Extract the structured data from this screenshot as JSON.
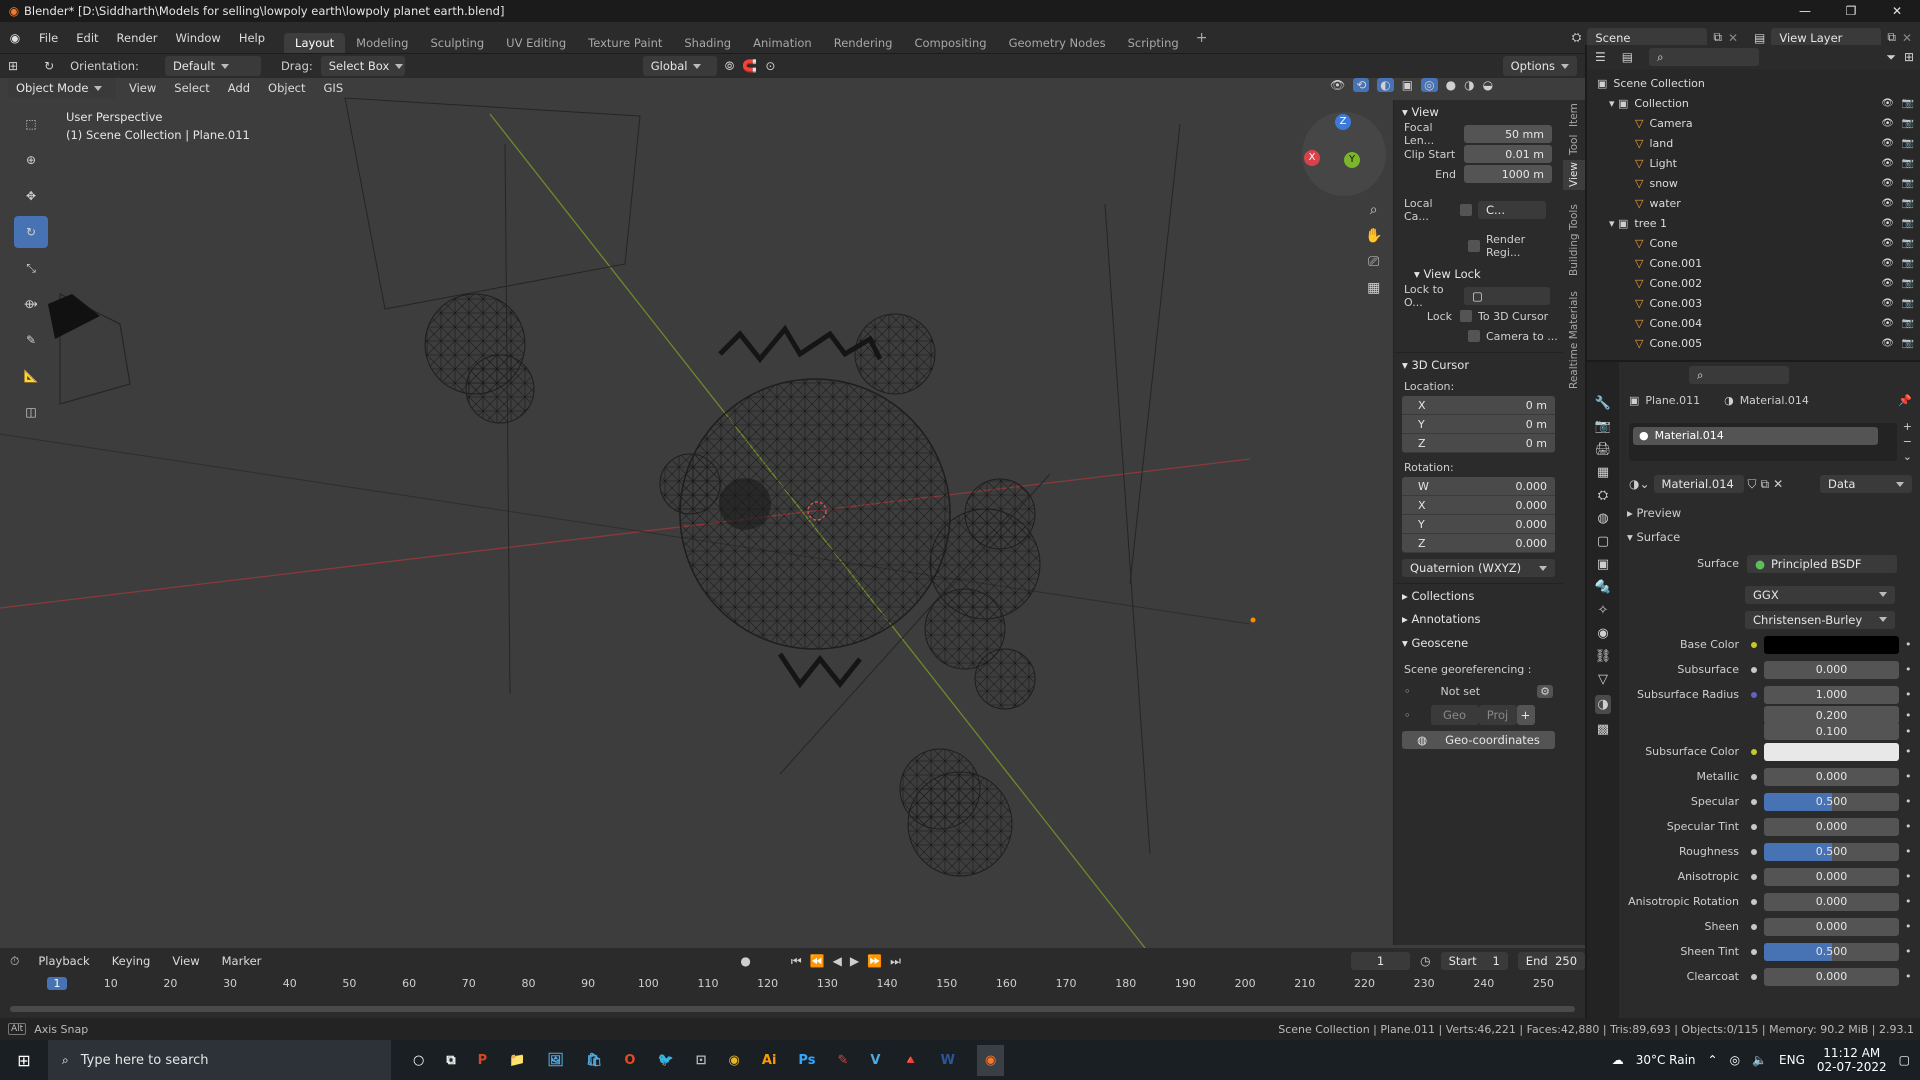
{
  "window": {
    "title": "Blender* [D:\\Siddharth\\Models for selling\\lowpoly earth\\lowpoly planet earth.blend]"
  },
  "menubar": {
    "menus": [
      "File",
      "Edit",
      "Render",
      "Window",
      "Help"
    ],
    "workspaces": [
      "Layout",
      "Modeling",
      "Sculpting",
      "UV Editing",
      "Texture Paint",
      "Shading",
      "Animation",
      "Rendering",
      "Compositing",
      "Geometry Nodes",
      "Scripting"
    ],
    "add_tab": "+",
    "scene_label": "Scene",
    "view_layer_label": "View Layer"
  },
  "viewport_header": {
    "orientation_label": "Orientation:",
    "orientation_value": "Default",
    "drag_label": "Drag:",
    "drag_value": "Select Box",
    "transform_orientation": "Global",
    "options": "Options",
    "mode": "Object Mode",
    "menus": [
      "View",
      "Select",
      "Add",
      "Object",
      "GIS"
    ]
  },
  "viewport": {
    "perspective": "User Perspective",
    "context": "(1) Scene Collection | Plane.011",
    "gizmo": {
      "x": "X",
      "y": "Y",
      "z": "Z"
    }
  },
  "npanel": {
    "view": {
      "header": "View",
      "focal_label": "Focal Len...",
      "focal_value": "50 mm",
      "clip_start_label": "Clip Start",
      "clip_start_value": "0.01 m",
      "end_label": "End",
      "end_value": "1000 m",
      "local_camera_label": "Local Ca...",
      "local_camera_value": "C...",
      "render_region": "Render Regi..."
    },
    "view_lock": {
      "header": "View Lock",
      "lock_to_label": "Lock to O...",
      "lock_label": "Lock",
      "to_cursor": "To 3D Cursor",
      "camera_to": "Camera to ..."
    },
    "cursor": {
      "header": "3D Cursor",
      "location_label": "Location:",
      "location": [
        {
          "axis": "X",
          "value": "0 m"
        },
        {
          "axis": "Y",
          "value": "0 m"
        },
        {
          "axis": "Z",
          "value": "0 m"
        }
      ],
      "rotation_label": "Rotation:",
      "rotation": [
        {
          "axis": "W",
          "value": "0.000"
        },
        {
          "axis": "X",
          "value": "0.000"
        },
        {
          "axis": "Y",
          "value": "0.000"
        },
        {
          "axis": "Z",
          "value": "0.000"
        }
      ],
      "rotation_mode": "Quaternion (WXYZ)"
    },
    "collections": "Collections",
    "annotations": "Annotations",
    "geoscene": {
      "header": "Geoscene",
      "georef_label": "Scene georeferencing :",
      "not_set": "Not set",
      "geo": "Geo",
      "proj": "Proj",
      "plus": "+",
      "geo_coordinates": "Geo-coordinates"
    },
    "tabs": [
      "Item",
      "Tool",
      "View",
      "Building Tools",
      "Realtime Materials"
    ]
  },
  "outliner": {
    "root": "Scene Collection",
    "collection": "Collection",
    "items": [
      "Camera",
      "land",
      "Light",
      "snow",
      "water"
    ],
    "tree": "tree 1",
    "tree_items": [
      "Cone",
      "Cone.001",
      "Cone.002",
      "Cone.003",
      "Cone.004",
      "Cone.005"
    ]
  },
  "properties": {
    "object_name": "Plane.011",
    "material_header": "Material.014",
    "slot_name": "Material.014",
    "material_name": "Material.014",
    "link": "Data",
    "preview": "Preview",
    "surface_header": "Surface",
    "surface_label": "Surface",
    "surface_value": "Principled BSDF",
    "distribution": "GGX",
    "subsurface_method": "Christensen-Burley",
    "rows": [
      {
        "label": "Base Color",
        "type": "color",
        "value": "",
        "color": "#000000"
      },
      {
        "label": "Subsurface",
        "type": "num",
        "value": "0.000",
        "fill": 0
      },
      {
        "label": "Subsurface Radius",
        "type": "num",
        "value": "1.000",
        "fill": 0
      },
      {
        "label": "",
        "type": "num",
        "value": "0.200",
        "fill": 0
      },
      {
        "label": "",
        "type": "num",
        "value": "0.100",
        "fill": 0
      },
      {
        "label": "Subsurface Color",
        "type": "color",
        "value": "",
        "color": "#e8e8e8"
      },
      {
        "label": "Metallic",
        "type": "num",
        "value": "0.000",
        "fill": 0
      },
      {
        "label": "Specular",
        "type": "num",
        "value": "0.500",
        "fill": 0.5
      },
      {
        "label": "Specular Tint",
        "type": "num",
        "value": "0.000",
        "fill": 0
      },
      {
        "label": "Roughness",
        "type": "num",
        "value": "0.500",
        "fill": 0.5
      },
      {
        "label": "Anisotropic",
        "type": "num",
        "value": "0.000",
        "fill": 0
      },
      {
        "label": "Anisotropic Rotation",
        "type": "num",
        "value": "0.000",
        "fill": 0
      },
      {
        "label": "Sheen",
        "type": "num",
        "value": "0.000",
        "fill": 0
      },
      {
        "label": "Sheen Tint",
        "type": "num",
        "value": "0.500",
        "fill": 0.5
      },
      {
        "label": "Clearcoat",
        "type": "num",
        "value": "0.000",
        "fill": 0
      }
    ]
  },
  "timeline": {
    "menus": [
      "Playback",
      "Keying",
      "View",
      "Marker"
    ],
    "current_frame": "1",
    "start_label": "Start",
    "start_value": "1",
    "end_label": "End",
    "end_value": "250",
    "ticks": [
      "1",
      "10",
      "20",
      "30",
      "40",
      "50",
      "60",
      "70",
      "80",
      "90",
      "100",
      "110",
      "120",
      "130",
      "140",
      "150",
      "160",
      "170",
      "180",
      "190",
      "200",
      "210",
      "220",
      "230",
      "240",
      "250"
    ]
  },
  "statusbar": {
    "left": "Axis Snap",
    "right": "Scene Collection | Plane.011 | Verts:46,221 | Faces:42,880 | Tris:89,693 | Objects:0/115 | Memory: 90.2 MiB | 2.93.1"
  },
  "taskbar": {
    "search_placeholder": "Type here to search",
    "weather": "30°C  Rain",
    "lang": "ENG",
    "time": "11:12 AM",
    "date": "02-07-2022"
  }
}
